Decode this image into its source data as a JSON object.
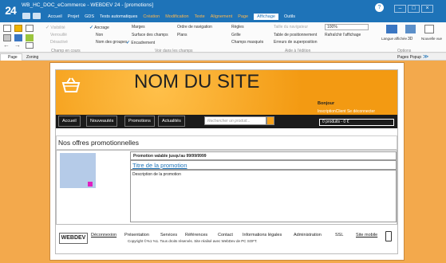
{
  "app": {
    "logo": "24",
    "title": "WB_HC_DOC_eCommerce - WEBDEV 24 - [promotions]"
  },
  "menu": [
    {
      "label": "Accueil",
      "style": "normal"
    },
    {
      "label": "Projet",
      "style": "normal"
    },
    {
      "label": "GDS",
      "style": "normal"
    },
    {
      "label": "Tests automatiques",
      "style": "normal"
    },
    {
      "label": "Création",
      "style": "orange"
    },
    {
      "label": "Modification",
      "style": "orange"
    },
    {
      "label": "Texte",
      "style": "orange"
    },
    {
      "label": "Alignement",
      "style": "orange"
    },
    {
      "label": "Page",
      "style": "orange"
    },
    {
      "label": "Affichage",
      "style": "active"
    },
    {
      "label": "Outils",
      "style": "normal"
    }
  ],
  "ribbon": {
    "visibilite": "Visibilité",
    "verrouille": "Verrouillé",
    "desactive": "Désactivé",
    "ancrage": "Ancrage",
    "non": "Non",
    "nom_groupes": "Nom des groupes",
    "marges": "Marges",
    "surface": "Surface des champs",
    "encadrement": "Encadrement",
    "ordre_nav": "Ordre de navigation",
    "plans": "Plans",
    "regles": "Règles",
    "grille": "Grille",
    "champs_masques": "Champs masqués",
    "taille_nav": "Taille du navigateur",
    "zoom": "100%",
    "table_pos": "Table de positionnement",
    "rafraichir": "Rafraîchir l'affichage",
    "erreurs": "Erreurs de superposition",
    "langue": "Langue affichée",
    "btn_3d": "3D",
    "nouvelle_vue": "Nouvelle vue",
    "groups": {
      "champ": "Champ en cours",
      "voir": "Voir dans les champs",
      "aide": "Aide à l'édition",
      "options": "Options"
    }
  },
  "tabs": {
    "page": "Page",
    "zoning": "Zoning",
    "pages_popup": "Pages Popup"
  },
  "site": {
    "name": "NOM DU SITE",
    "nav": [
      "Accueil",
      "Nouveautés",
      "Promotions",
      "Actualités"
    ],
    "search_placeholder": "Rechercher un produit...",
    "bonjour": "Bonjour",
    "login": "InscriptionClient   Se déconnecter",
    "cart": "0 produits - 0 €",
    "offers_title": "Nos offres promotionnelles",
    "promo_header": "Promotion valable jusqu'au 99/99/9999",
    "promo_title": "Titre de la promotion",
    "promo_desc": "Description de la promotion",
    "footer_links": [
      "Déconnexion",
      "Présentation",
      "Services",
      "Références",
      "Contact",
      "Informations légales",
      "Administration",
      "SSL"
    ],
    "site_mobile": "Site mobile",
    "copyright": "Copyright ©%1 %1. Tous droits réservés. Site réalisé avec WebDev de PC SOFT.",
    "badge": "WEBDEV"
  },
  "colors": {
    "titlebar": "#1e73b8",
    "editor_bg": "#f3a94c",
    "header_orange": "#f6a21c",
    "nav_bg": "#1b1b1b"
  }
}
